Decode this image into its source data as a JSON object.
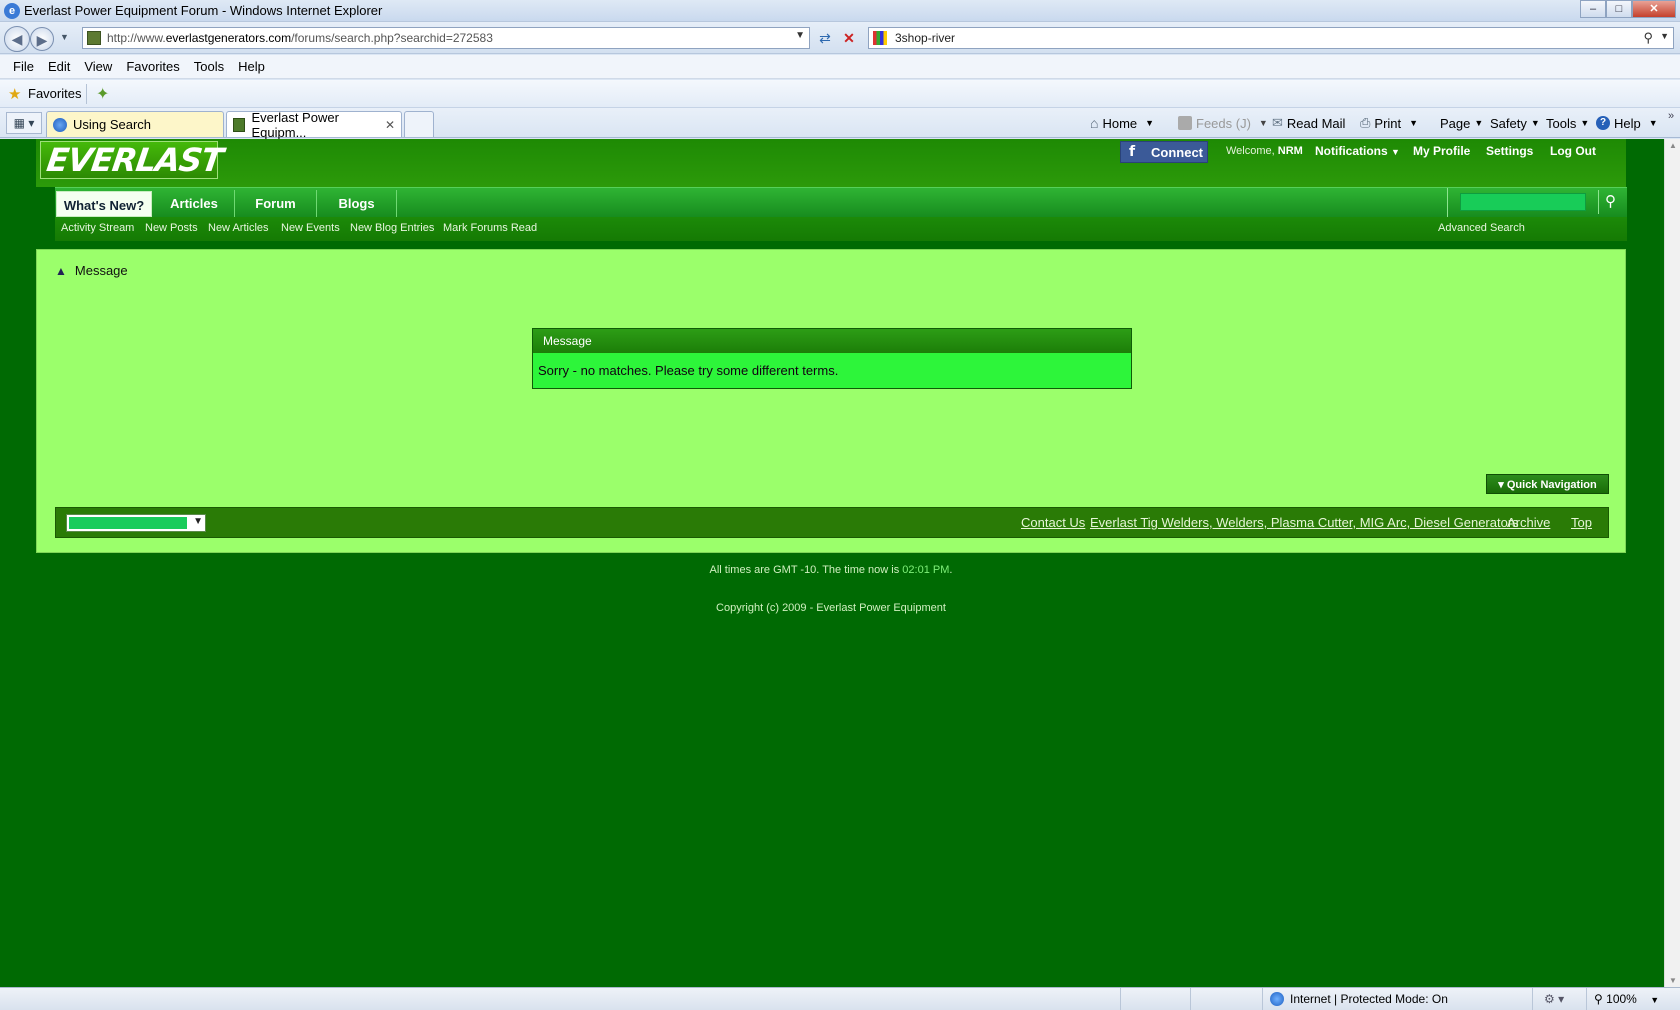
{
  "window": {
    "title": "Everlast Power Equipment Forum - Windows Internet Explorer",
    "controls": [
      "–",
      "□",
      "✕"
    ]
  },
  "address": {
    "url_prefix": "http://www.",
    "url_domain": "everlastgenerators.com",
    "url_path": "/forums/search.php?searchid=272583",
    "search_text": "3shop-river"
  },
  "menubar": [
    "File",
    "Edit",
    "View",
    "Favorites",
    "Tools",
    "Help"
  ],
  "favorites": {
    "label": "Favorites"
  },
  "tabs": [
    {
      "label": "Using Search"
    },
    {
      "label": "Everlast Power Equipm..."
    }
  ],
  "commandbar": {
    "home": "Home",
    "feeds": "Feeds (J)",
    "read_mail": "Read Mail",
    "print": "Print",
    "page": "Page",
    "safety": "Safety",
    "tools": "Tools",
    "help": "Help"
  },
  "site": {
    "logo_text": "EVERLAST",
    "fb_connect": "Connect",
    "welcome_prefix": "Welcome,",
    "username": "NRM",
    "notifications": "Notifications",
    "my_profile": "My Profile",
    "settings": "Settings",
    "logout": "Log Out",
    "nav_tabs": [
      "What's New?",
      "Articles",
      "Forum",
      "Blogs"
    ],
    "subnav": [
      "Activity Stream",
      "New Posts",
      "New Articles",
      "New Events",
      "New Blog Entries",
      "Mark Forums Read"
    ],
    "advanced_search": "Advanced Search",
    "breadcrumb": "Message",
    "message_header": "Message",
    "message_body": "Sorry - no matches. Please try some different terms.",
    "quick_navigation": "Quick Navigation",
    "footer_links": [
      "Contact Us",
      "Everlast Tig Welders, Welders, Plasma Cutter, MIG Arc, Diesel Generators",
      "Archive",
      "Top"
    ],
    "times_prefix": "All times are GMT -10. The time now is ",
    "time_now": "02:01 PM",
    "times_suffix": ".",
    "copyright": "Copyright (c) 2009 - Everlast Power Equipment"
  },
  "status": {
    "zone": "Internet | Protected Mode: On",
    "zoom": "100%"
  },
  "colors": {
    "page_bg": "#006a03",
    "content_bg": "#9bff6b",
    "nav_green": "#178c1e",
    "message_body_bg": "#2df53a"
  }
}
